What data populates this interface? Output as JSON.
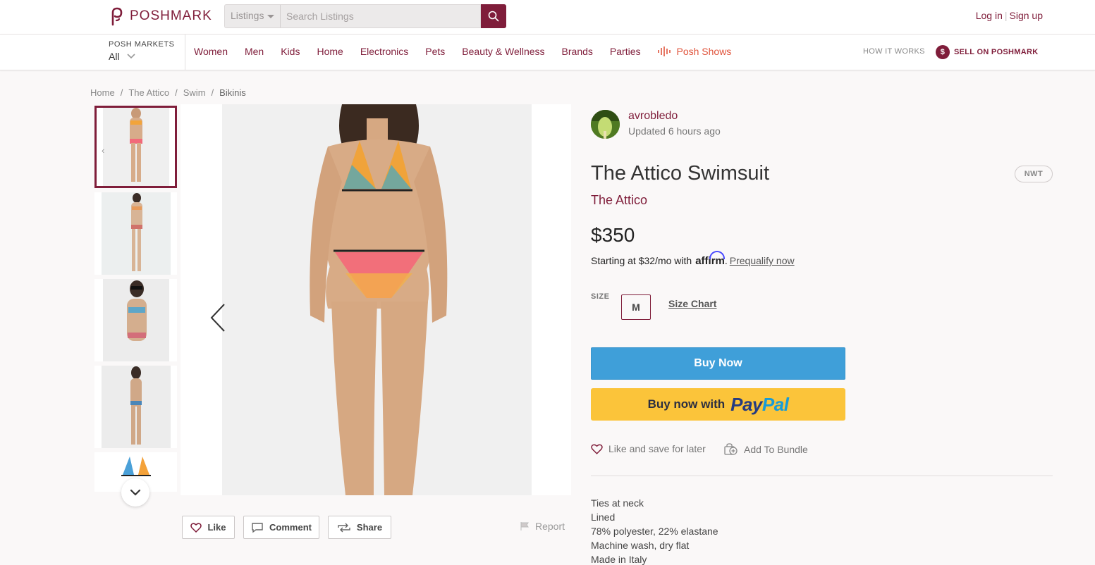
{
  "header": {
    "logo_text": "POSHMARK",
    "search_category": "Listings",
    "search_placeholder": "Search Listings",
    "login": "Log in",
    "auth_sep": "|",
    "signup": "Sign up"
  },
  "nav": {
    "markets_label": "POSH MARKETS",
    "markets_value": "All",
    "links": [
      "Women",
      "Men",
      "Kids",
      "Home",
      "Electronics",
      "Pets",
      "Beauty & Wellness",
      "Brands",
      "Parties"
    ],
    "posh_shows": "Posh Shows",
    "how_it_works": "HOW IT WORKS",
    "sell": "SELL ON POSHMARK",
    "sell_icon": "$"
  },
  "breadcrumb": [
    "Home",
    "The Attico",
    "Swim",
    "Bikinis"
  ],
  "breadcrumb_sep": "/",
  "listing": {
    "seller": "avrobledo",
    "updated": "Updated 6 hours ago",
    "title": "The Attico Swimsuit",
    "condition": "NWT",
    "brand": "The Attico",
    "price": "$350",
    "affirm_prefix": "Starting at $32/mo with",
    "affirm_logo": "affirm",
    "affirm_suffix": ".",
    "prequalify": "Prequalify now",
    "size_label": "SIZE",
    "size": "M",
    "size_chart": "Size Chart",
    "buy_now": "Buy Now",
    "paypal_prefix": "Buy now with",
    "paypal_pay": "Pay",
    "paypal_pal": "Pal",
    "like_save": "Like and save for later",
    "add_bundle": "Add To Bundle",
    "description": [
      "Ties at neck",
      "Lined",
      "78% polyester, 22% elastane",
      "Machine wash, dry flat",
      "Made in Italy"
    ]
  },
  "actions": {
    "like": "Like",
    "comment": "Comment",
    "share": "Share",
    "report": "Report"
  },
  "colors": {
    "brand": "#7f1d3a",
    "buy_now": "#3f9fd9",
    "paypal_bg": "#fbc43a",
    "posh_shows": "#e0543c"
  }
}
